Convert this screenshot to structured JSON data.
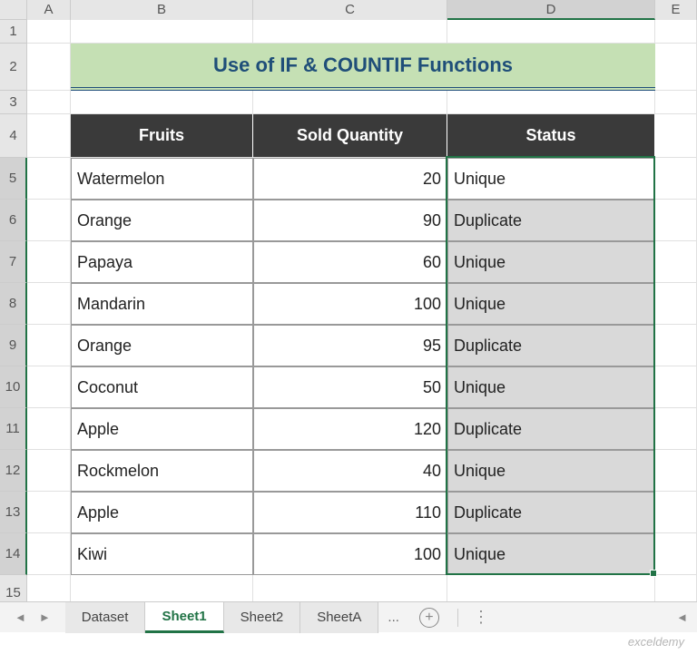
{
  "columns": [
    "A",
    "B",
    "C",
    "D",
    "E"
  ],
  "rows": [
    "1",
    "2",
    "3",
    "4",
    "5",
    "6",
    "7",
    "8",
    "9",
    "10",
    "11",
    "12",
    "13",
    "14",
    "15"
  ],
  "title": "Use of IF & COUNTIF Functions",
  "headers": {
    "fruits": "Fruits",
    "qty": "Sold Quantity",
    "status": "Status"
  },
  "data": [
    {
      "fruit": "Watermelon",
      "qty": "20",
      "status": "Unique"
    },
    {
      "fruit": "Orange",
      "qty": "90",
      "status": "Duplicate"
    },
    {
      "fruit": "Papaya",
      "qty": "60",
      "status": "Unique"
    },
    {
      "fruit": "Mandarin",
      "qty": "100",
      "status": "Unique"
    },
    {
      "fruit": "Orange",
      "qty": "95",
      "status": "Duplicate"
    },
    {
      "fruit": "Coconut",
      "qty": "50",
      "status": "Unique"
    },
    {
      "fruit": "Apple",
      "qty": "120",
      "status": "Duplicate"
    },
    {
      "fruit": "Rockmelon",
      "qty": "40",
      "status": "Unique"
    },
    {
      "fruit": "Apple",
      "qty": "110",
      "status": "Duplicate"
    },
    {
      "fruit": "Kiwi",
      "qty": "100",
      "status": "Unique"
    }
  ],
  "tabs": {
    "items": [
      "Dataset",
      "Sheet1",
      "Sheet2",
      "SheetA"
    ],
    "active": "Sheet1",
    "more": "..."
  },
  "watermark": "exceldemy"
}
